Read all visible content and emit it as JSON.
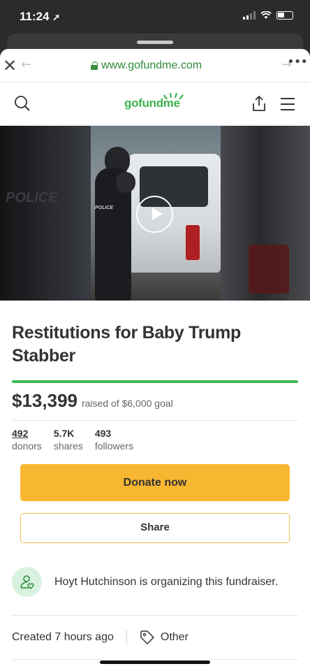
{
  "status_bar": {
    "time": "11:24",
    "location_glyph": "➚"
  },
  "browser": {
    "url": "www.gofundme.com",
    "close_glyph": "✕",
    "back_glyph": "←",
    "forward_glyph": "→",
    "more_glyph": "•••"
  },
  "site": {
    "logo_text": "gofundme",
    "brand_color": "#3eb34f"
  },
  "video": {
    "overlay_text": "POLICE",
    "badge_text": "POLICE"
  },
  "campaign": {
    "title": "Restitutions for Baby Trump Stabber",
    "raised": "$13,399",
    "goal_text": "raised of $6,000 goal",
    "progress_fraction": 1.0,
    "stats": [
      {
        "value": "492",
        "label": "donors"
      },
      {
        "value": "5.7K",
        "label": "shares"
      },
      {
        "value": "493",
        "label": "followers"
      }
    ],
    "donate_label": "Donate now",
    "share_label": "Share",
    "organizer_text": "Hoyt Hutchinson is organizing this fundraiser.",
    "created_text": "Created 7 hours ago",
    "category": "Other"
  },
  "colors": {
    "donate": "#f8b731",
    "progress": "#3dbb55",
    "url_green": "#2e8b3a"
  }
}
